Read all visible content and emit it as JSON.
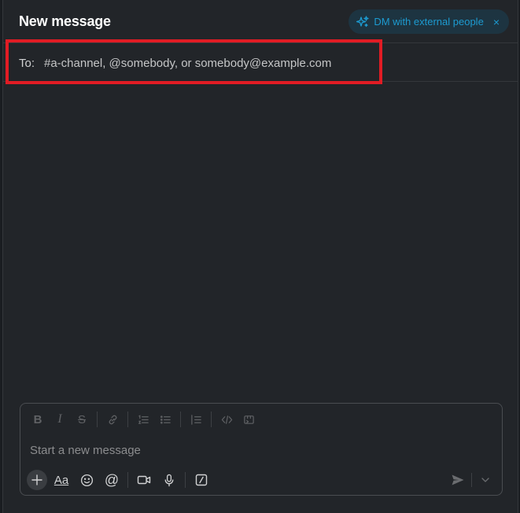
{
  "header": {
    "title": "New message",
    "external_dm_label": "DM with external people",
    "external_dm_close": "×"
  },
  "to_row": {
    "label": "To:",
    "placeholder": "#a-channel, @somebody, or somebody@example.com"
  },
  "composer": {
    "placeholder": "Start a new message",
    "formatting_icons": [
      "bold-icon",
      "italic-icon",
      "strikethrough-icon",
      "link-icon",
      "ordered-list-icon",
      "bulleted-list-icon",
      "blockquote-icon",
      "code-icon",
      "code-block-icon"
    ],
    "formatting_glyphs": {
      "bold": "B",
      "italic": "I",
      "strike": "S"
    },
    "action_icons": [
      "plus-icon",
      "formatting-toggle-icon",
      "emoji-icon",
      "mention-icon",
      "video-icon",
      "microphone-icon",
      "slash-command-icon"
    ],
    "format_toggle_label": "Aa",
    "mention_glyph": "@",
    "send_icons": [
      "send-icon",
      "chevron-down-icon"
    ]
  },
  "colors": {
    "background": "#222529",
    "accent": "#1d9bd1",
    "highlight_border": "#e11c24",
    "pill_bg": "#1d3441"
  }
}
